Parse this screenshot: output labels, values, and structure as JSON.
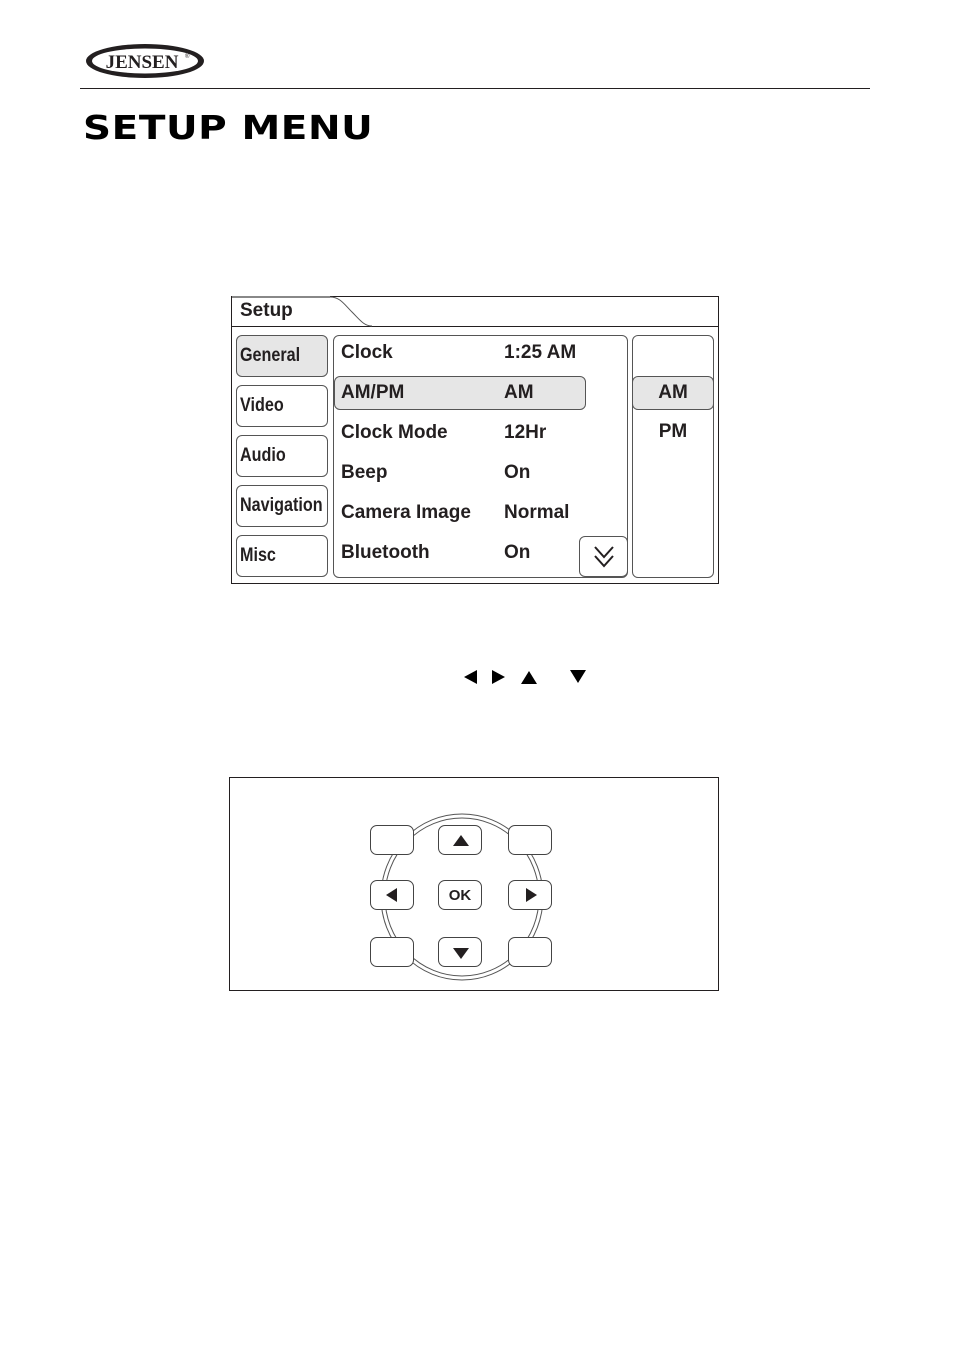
{
  "header": {
    "brand": "JENSEN",
    "brand_mark": "®",
    "page_title": "SETUP MENU"
  },
  "setup_screen": {
    "tab_title": "Setup",
    "categories": [
      {
        "label": "General",
        "active": true
      },
      {
        "label": "Video",
        "active": false
      },
      {
        "label": "Audio",
        "active": false
      },
      {
        "label": "Navigation",
        "active": false
      },
      {
        "label": "Misc",
        "active": false
      }
    ],
    "settings": [
      {
        "label": "Clock",
        "value": "1:25 AM",
        "active": false
      },
      {
        "label": "AM/PM",
        "value": "AM",
        "active": true
      },
      {
        "label": "Clock Mode",
        "value": "12Hr",
        "active": false
      },
      {
        "label": "Beep",
        "value": "On",
        "active": false
      },
      {
        "label": "Camera Image",
        "value": "Normal",
        "active": false
      },
      {
        "label": "Bluetooth",
        "value": "On",
        "active": false
      }
    ],
    "scroll_icon": "double-chevron-down-icon",
    "options": [
      {
        "label": "AM",
        "active": true
      },
      {
        "label": "PM",
        "active": false
      }
    ]
  },
  "inline_arrows": [
    "left-arrow-icon",
    "right-arrow-icon",
    "up-arrow-icon",
    "down-arrow-icon"
  ],
  "remote_pad": {
    "ok_label": "OK",
    "buttons": [
      "top-left",
      "up",
      "top-right",
      "left",
      "ok",
      "right",
      "bottom-left",
      "down",
      "bottom-right"
    ]
  },
  "colors": {
    "ink": "#231f20",
    "highlight": "#e6e6e6",
    "border": "#555555"
  }
}
